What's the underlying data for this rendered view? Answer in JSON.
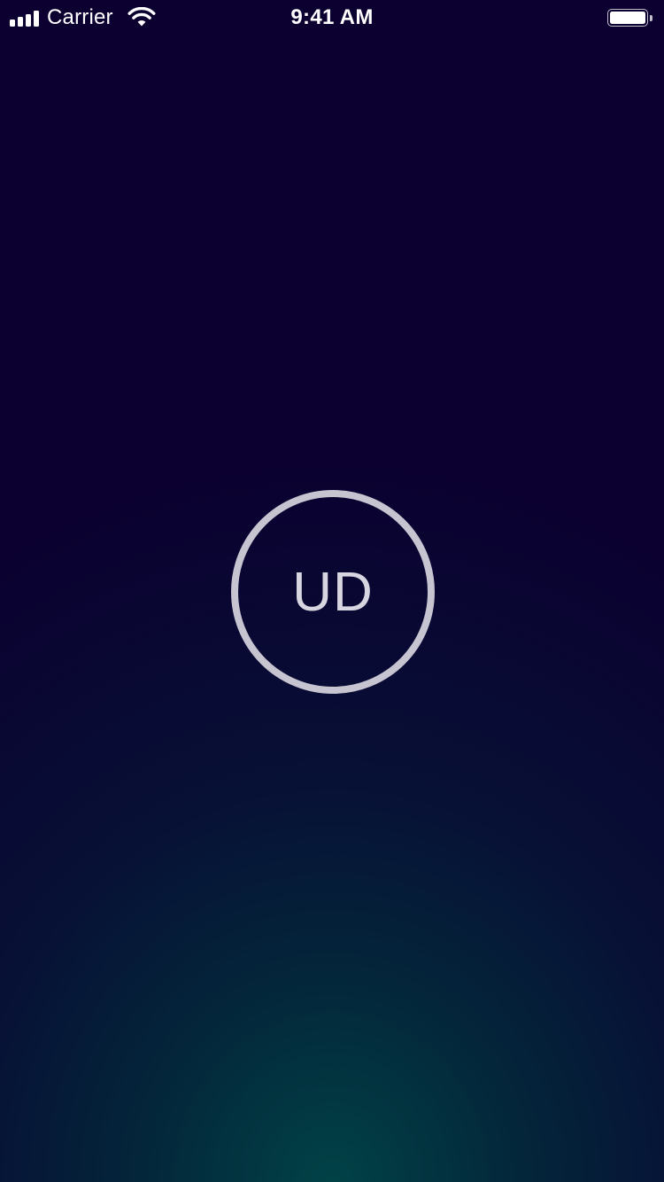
{
  "status_bar": {
    "carrier": "Carrier",
    "time": "9:41 AM",
    "signal_icon": "cellular-signal-icon",
    "wifi_icon": "wifi-icon",
    "battery_icon": "battery-icon",
    "battery_level": 1.0
  },
  "avatar": {
    "initials": "UD",
    "ring_color": "#c6c4d0"
  },
  "theme": {
    "background_top": "#0b0030",
    "background_bottom_glow": "#00464a"
  }
}
